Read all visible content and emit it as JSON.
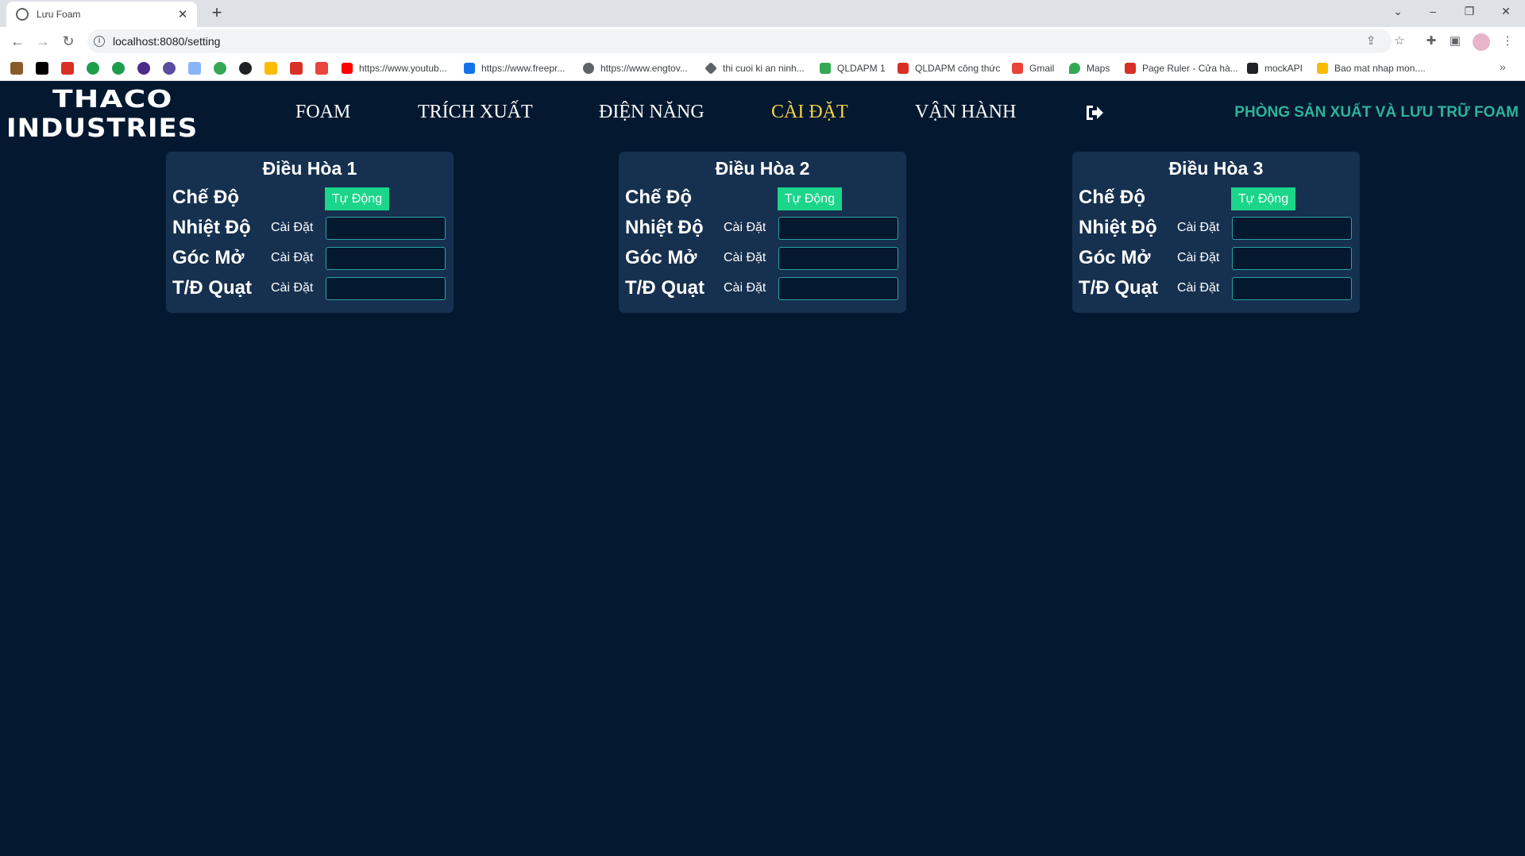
{
  "browser": {
    "tab_title": "Lưu Foam",
    "url": "localhost:8080/setting",
    "bookmarks": [
      {
        "label": "https://www.youtub...",
        "color": "#ff0000"
      },
      {
        "label": "https://www.freepr...",
        "color": "#1273eb"
      },
      {
        "label": "https://www.engtov...",
        "color": "#5f6368"
      },
      {
        "label": "thi cuoi ki an ninh...",
        "color": "#5f6368"
      },
      {
        "label": "QLDAPM 1",
        "color": "#34a853"
      },
      {
        "label": "QLDAPM công thức",
        "color": "#d93025"
      },
      {
        "label": "Gmail",
        "color": "#ea4335"
      },
      {
        "label": "Maps",
        "color": "#34a853"
      },
      {
        "label": "Page Ruler - Cửa hà...",
        "color": "#d93025"
      },
      {
        "label": "mockAPI",
        "color": "#202124"
      },
      {
        "label": "Bao mat nhap mon....",
        "color": "#fbbc04"
      }
    ]
  },
  "header": {
    "logo_top": "THACO",
    "logo_bottom": "INDUSTRIES",
    "nav": [
      "FOAM",
      "TRÍCH XUẤT",
      "ĐIỆN NĂNG",
      "CÀI ĐẶT",
      "VẬN HÀNH"
    ],
    "active_nav": "CÀI ĐẶT",
    "dept_title": "PHÒNG SẢN XUẤT VÀ LƯU TRỮ FOAM",
    "accent_color": "#f5d442",
    "dept_color": "#2cb39a"
  },
  "panels": [
    {
      "title": "Điều Hòa 1",
      "mode_label": "Chế Độ",
      "mode_value": "Tự Động",
      "rows": [
        {
          "label": "Nhiệt Độ",
          "sub": "Cài Đặt",
          "value": ""
        },
        {
          "label": "Góc Mở",
          "sub": "Cài Đặt",
          "value": ""
        },
        {
          "label": "T/Đ Quạt",
          "sub": "Cài Đặt",
          "value": ""
        }
      ]
    },
    {
      "title": "Điều Hòa 2",
      "mode_label": "Chế Độ",
      "mode_value": "Tự Động",
      "rows": [
        {
          "label": "Nhiệt Độ",
          "sub": "Cài Đặt",
          "value": ""
        },
        {
          "label": "Góc Mở",
          "sub": "Cài Đặt",
          "value": ""
        },
        {
          "label": "T/Đ Quạt",
          "sub": "Cài Đặt",
          "value": ""
        }
      ]
    },
    {
      "title": "Điều Hòa 3",
      "mode_label": "Chế Độ",
      "mode_value": "Tự Động",
      "rows": [
        {
          "label": "Nhiệt Độ",
          "sub": "Cài Đặt",
          "value": ""
        },
        {
          "label": "Góc Mở",
          "sub": "Cài Đặt",
          "value": ""
        },
        {
          "label": "T/Đ Quạt",
          "sub": "Cài Đặt",
          "value": ""
        }
      ]
    }
  ],
  "colors": {
    "page_bg": "#041830",
    "panel_bg": "#16304f",
    "mode_button": "#1ad58a",
    "input_border": "#29a3a3"
  }
}
